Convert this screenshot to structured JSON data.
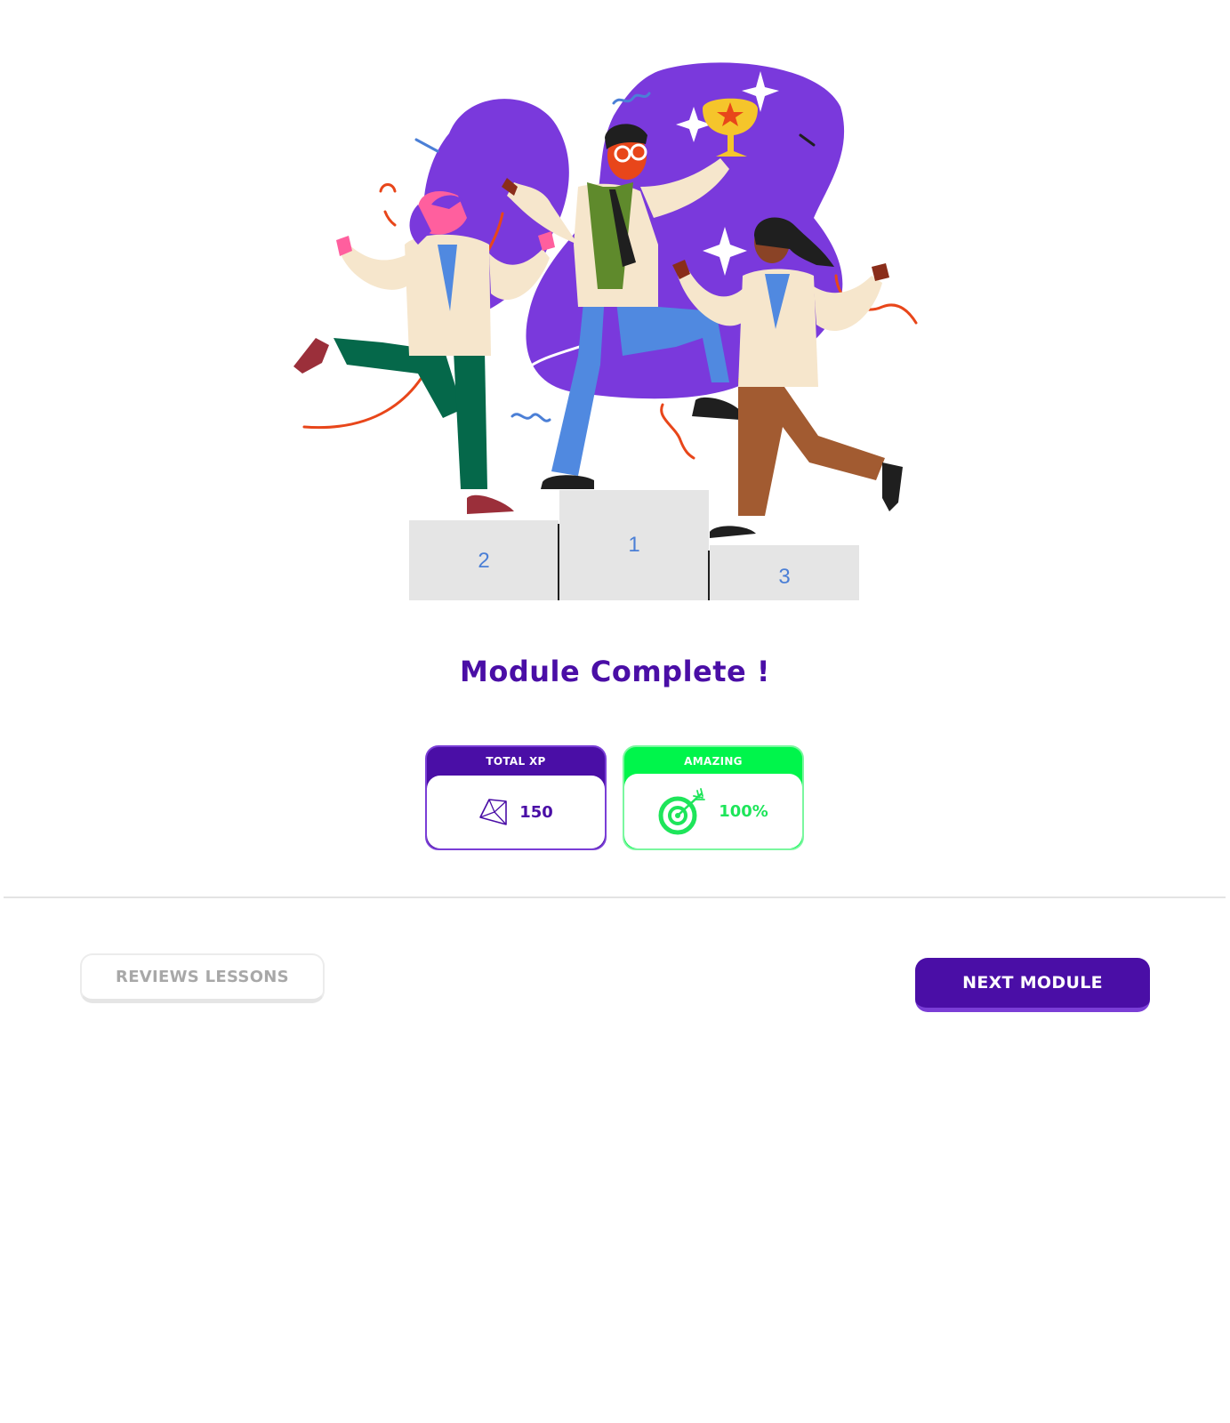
{
  "page": {
    "title": "Module Complete !"
  },
  "illustration": {
    "podium": {
      "first": "1",
      "second": "2",
      "third": "3"
    }
  },
  "stats": {
    "xp": {
      "label": "TOTAL XP",
      "value": "150",
      "icon": "diamond-icon",
      "color": "#4a0ea6"
    },
    "accuracy": {
      "label": "AMAZING",
      "value": "100%",
      "icon": "target-icon",
      "color": "#00f54b"
    }
  },
  "actions": {
    "review_label": "REVIEWS LESSONS",
    "next_label": "NEXT MODULE"
  },
  "colors": {
    "brand_purple": "#4a0ea6",
    "success_green": "#00f54b",
    "podium_grey": "#e5e5e5",
    "podium_number": "#4b7fd6"
  }
}
